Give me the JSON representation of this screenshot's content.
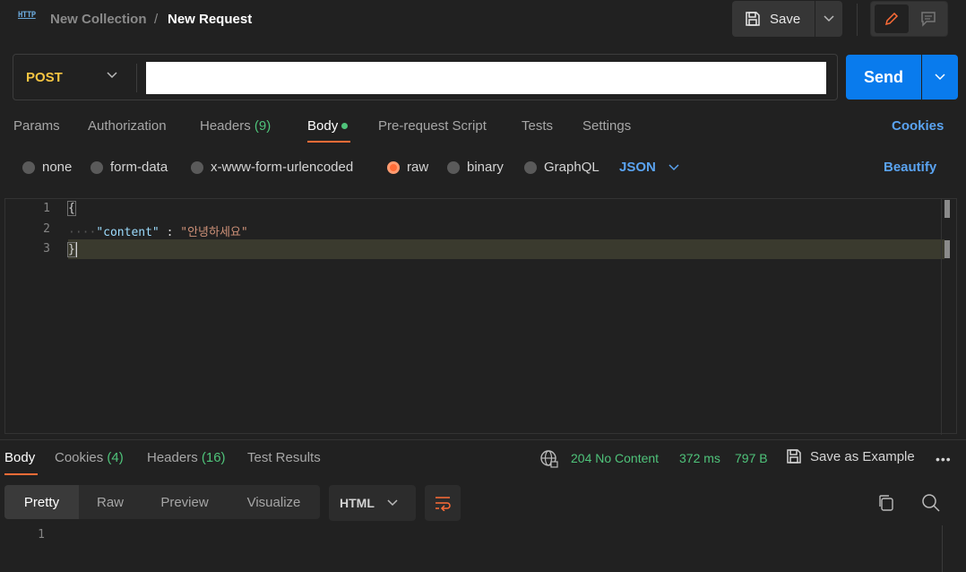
{
  "header": {
    "http_badge": "HTTP",
    "collection": "New Collection",
    "separator": "/",
    "request_name": "New Request",
    "save_label": "Save"
  },
  "request": {
    "method": "POST",
    "url_value": "",
    "send_label": "Send"
  },
  "request_tabs": {
    "params": "Params",
    "authorization": "Authorization",
    "headers": "Headers",
    "headers_count": "(9)",
    "body": "Body",
    "pre_request": "Pre-request Script",
    "tests": "Tests",
    "settings": "Settings",
    "cookies": "Cookies"
  },
  "body_types": {
    "none": "none",
    "form_data": "form-data",
    "urlencoded": "x-www-form-urlencoded",
    "raw": "raw",
    "binary": "binary",
    "graphql": "GraphQL",
    "selected": "raw",
    "language": "JSON",
    "beautify": "Beautify"
  },
  "editor": {
    "lines": [
      "1",
      "2",
      "3"
    ],
    "open_brace": "{",
    "indent": "····",
    "key": "\"content\"",
    "colon": " : ",
    "value": "\"안녕하세요\"",
    "close_brace": "}"
  },
  "response_tabs": {
    "body": "Body",
    "cookies": "Cookies",
    "cookies_count": "(4)",
    "headers": "Headers",
    "headers_count": "(16)",
    "test_results": "Test Results",
    "status": "204 No Content",
    "time": "372 ms",
    "size": "797 B",
    "save_example": "Save as Example",
    "more": "•••"
  },
  "response_toolbar": {
    "pretty": "Pretty",
    "raw": "Raw",
    "preview": "Preview",
    "visualize": "Visualize",
    "format": "HTML"
  },
  "response_editor": {
    "line": "1"
  },
  "colors": {
    "accent_orange": "#ff6c37",
    "send_blue": "#097bed",
    "link_blue": "#5aa3f0",
    "success_green": "#4fc37a",
    "method_yellow": "#f5c542"
  }
}
